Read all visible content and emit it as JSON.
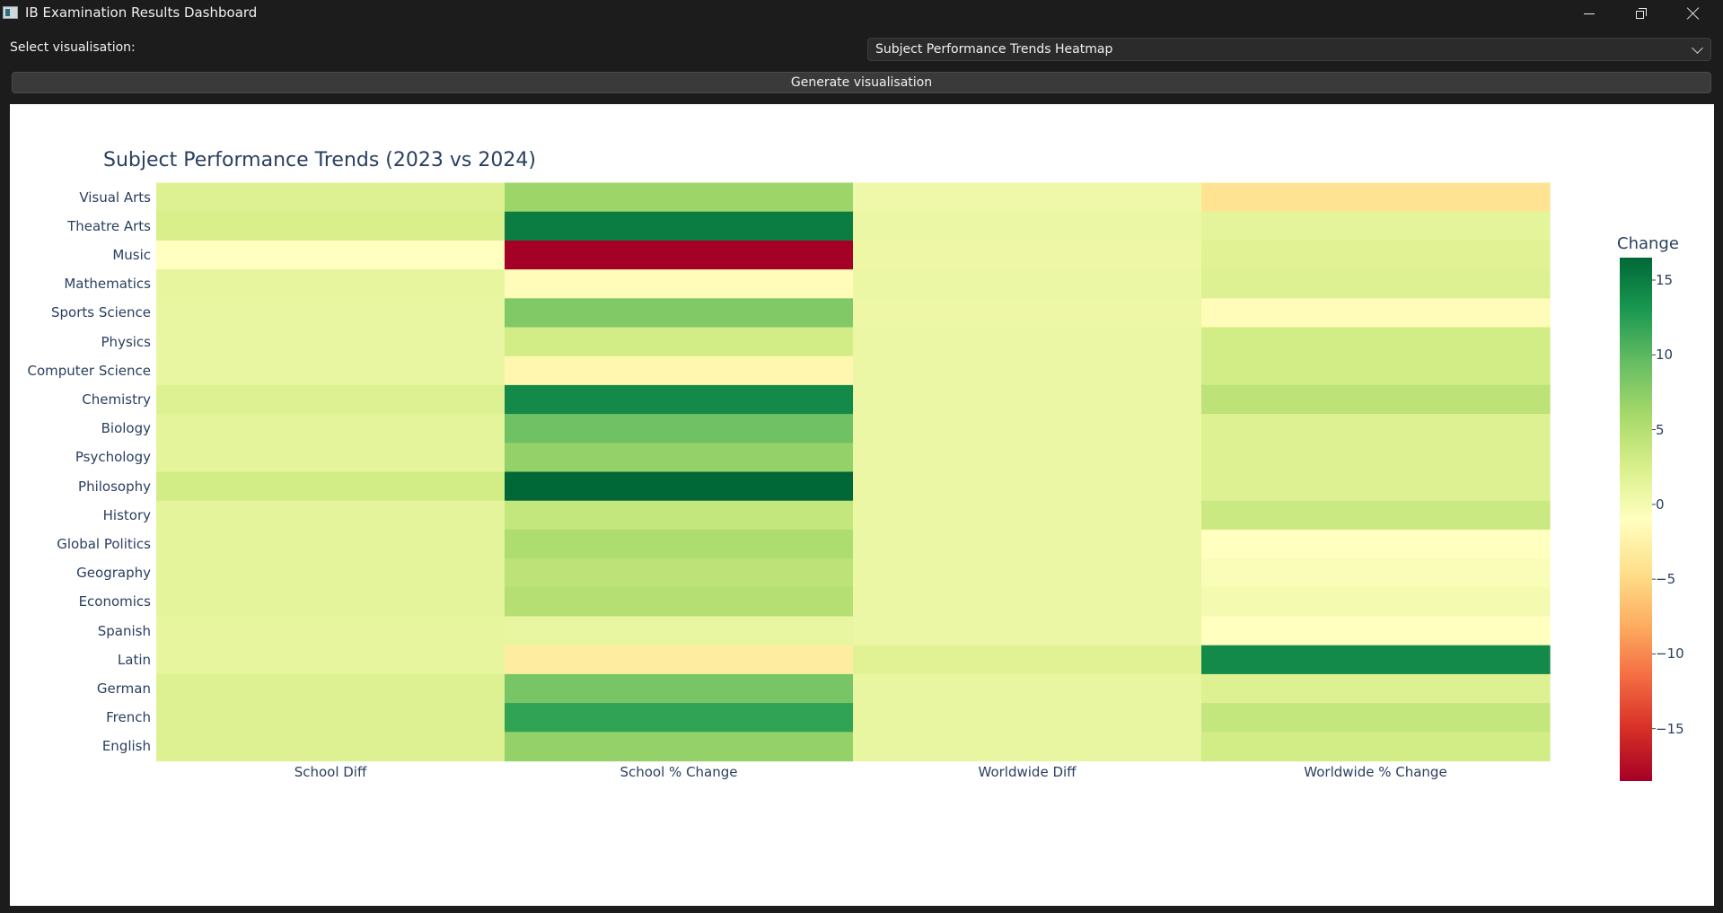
{
  "window": {
    "title": "IB Examination Results Dashboard"
  },
  "controls": {
    "select_label": "Select visualisation:",
    "select_value": "Subject Performance Trends Heatmap",
    "generate_label": "Generate visualisation"
  },
  "icons": [
    "app-icon",
    "minimize-icon",
    "restore-icon",
    "close-icon",
    "chevron-down-icon"
  ],
  "chart_data": {
    "type": "heatmap",
    "title": "Subject Performance Trends (2023 vs 2024)",
    "colorbar_title": "Change",
    "colorscale": "RdYlGn",
    "zmin": -18.5,
    "zmax": 16.5,
    "colorbar_ticks": [
      15,
      10,
      5,
      0,
      -5,
      -10,
      -15
    ],
    "columns": [
      "School Diff",
      "School % Change",
      "Worldwide Diff",
      "Worldwide % Change"
    ],
    "rows": [
      "Visual Arts",
      "Theatre Arts",
      "Music",
      "Mathematics",
      "Sports Science",
      "Physics",
      "Computer Science",
      "Chemistry",
      "Biology",
      "Psychology",
      "Philosophy",
      "History",
      "Global Politics",
      "Geography",
      "Economics",
      "Spanish",
      "Latin",
      "German",
      "French",
      "English"
    ],
    "values": [
      [
        2.0,
        6.5,
        0.5,
        -4.0
      ],
      [
        2.5,
        15.0,
        0.8,
        1.5
      ],
      [
        -1.0,
        -18.5,
        0.7,
        1.8
      ],
      [
        1.2,
        -1.5,
        0.8,
        2.0
      ],
      [
        1.0,
        8.0,
        0.7,
        -1.5
      ],
      [
        1.0,
        3.0,
        0.8,
        3.0
      ],
      [
        1.0,
        -2.0,
        0.8,
        3.0
      ],
      [
        2.0,
        14.0,
        0.8,
        4.5
      ],
      [
        1.5,
        9.0,
        0.8,
        2.0
      ],
      [
        1.5,
        7.0,
        0.8,
        2.0
      ],
      [
        3.0,
        16.5,
        0.8,
        2.0
      ],
      [
        1.5,
        4.0,
        0.8,
        3.5
      ],
      [
        1.5,
        5.5,
        0.8,
        -1.0
      ],
      [
        1.5,
        4.5,
        0.8,
        -0.5
      ],
      [
        1.5,
        5.0,
        0.8,
        0.0
      ],
      [
        1.2,
        1.0,
        0.8,
        -1.0
      ],
      [
        1.2,
        -3.0,
        1.8,
        14.0
      ],
      [
        2.0,
        8.5,
        1.0,
        2.0
      ],
      [
        2.0,
        12.0,
        1.0,
        4.0
      ],
      [
        2.0,
        7.0,
        1.0,
        3.0
      ]
    ]
  }
}
